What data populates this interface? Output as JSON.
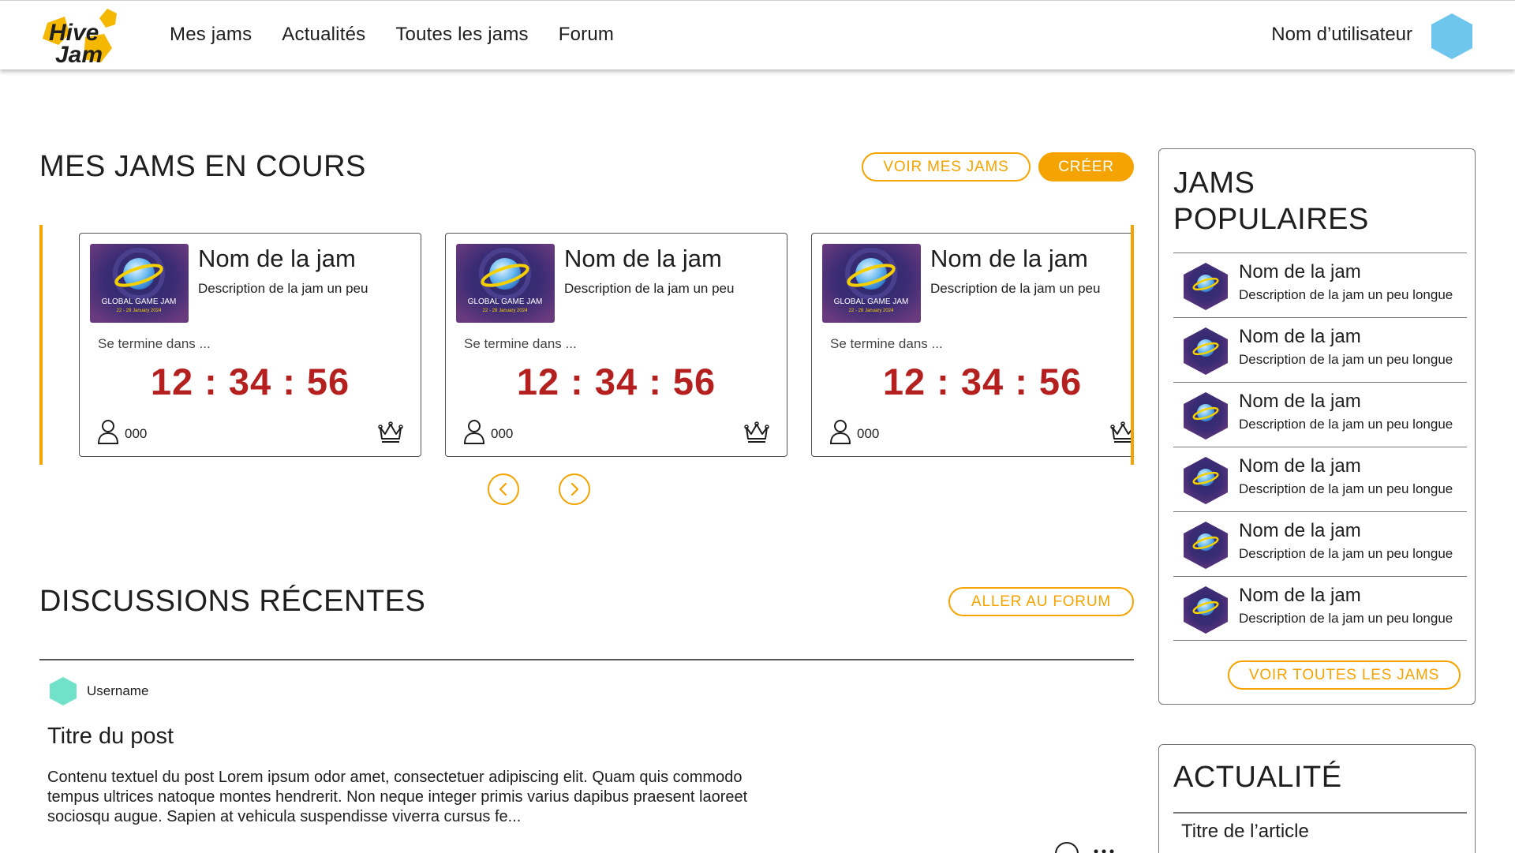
{
  "colors": {
    "accent": "#f5a300",
    "countdown": "#b3201f",
    "user_avatar": "#6ec6ec",
    "post_avatar": "#6fe2c9",
    "logo_yellow": "#f5b800"
  },
  "header": {
    "logo_line1": "Hive",
    "logo_line2": "Jam",
    "nav": [
      "Mes jams",
      "Actualités",
      "Toutes les jams",
      "Forum"
    ],
    "username": "Nom d’utilisateur"
  },
  "current_jams": {
    "title": "MES JAMS EN COURS",
    "see_mine_label": "VOIR MES JAMS",
    "create_label": "CRÉER",
    "cards": [
      {
        "name": "Nom de la jam",
        "description": "Description de la jam un peu",
        "ends_label": "Se termine dans ...",
        "countdown": "12 : 34 : 56",
        "participants": "000",
        "thumb_title": "GLOBAL GAME JAM",
        "thumb_dates": "22 - 28 January 2024"
      },
      {
        "name": "Nom de la jam",
        "description": "Description de la jam un peu",
        "ends_label": "Se termine dans ...",
        "countdown": "12 : 34 : 56",
        "participants": "000",
        "thumb_title": "GLOBAL GAME JAM",
        "thumb_dates": "22 - 28 January 2024"
      },
      {
        "name": "Nom de la jam",
        "description": "Description de la jam un peu",
        "ends_label": "Se termine dans ...",
        "countdown": "12 : 34 : 56",
        "participants": "000",
        "thumb_title": "GLOBAL GAME JAM",
        "thumb_dates": "22 - 28 January 2024"
      }
    ]
  },
  "discussions": {
    "title": "DISCUSSIONS RÉCENTES",
    "forum_label": "ALLER AU FORUM",
    "post": {
      "username": "Username",
      "title": "Titre du post",
      "body": "Contenu textuel du post Lorem ipsum odor amet, consectetuer adipiscing elit. Quam quis commodo tempus ultrices natoque montes hendrerit. Non neque integer primis varius dapibus praesent laoreet sociosqu augue. Sapien at vehicula suspendisse viverra cursus fe..."
    }
  },
  "popular": {
    "title_line1": "JAMS",
    "title_line2": "POPULAIRES",
    "items": [
      {
        "name": "Nom de la jam",
        "description": "Description de la jam un peu longue"
      },
      {
        "name": "Nom de la jam",
        "description": "Description de la jam un peu longue"
      },
      {
        "name": "Nom de la jam",
        "description": "Description de la jam un peu longue"
      },
      {
        "name": "Nom de la jam",
        "description": "Description de la jam un peu longue"
      },
      {
        "name": "Nom de la jam",
        "description": "Description de la jam un peu longue"
      },
      {
        "name": "Nom de la jam",
        "description": "Description de la jam un peu longue"
      }
    ],
    "see_all_label": "VOIR TOUTES LES JAMS"
  },
  "news": {
    "title": "ACTUALITÉ",
    "article_title": "Titre de l’article"
  }
}
